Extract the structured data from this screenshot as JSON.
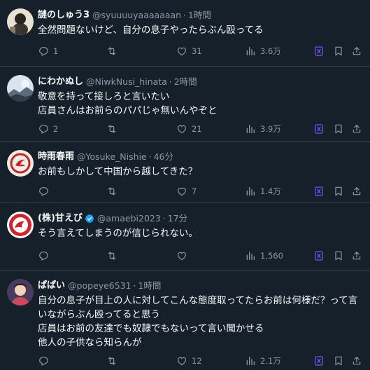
{
  "colors": {
    "background": "#15202b",
    "divider": "#38444d",
    "text": "#f7f9f9",
    "muted": "#8b98a5",
    "verified": "#1d9bf0",
    "grok_icon": "#7856ff"
  },
  "icons": {
    "reply": "reply-icon",
    "retweet": "retweet-icon",
    "like": "like-icon",
    "views": "views-icon",
    "grok": "grok-icon",
    "bookmark": "bookmark-icon",
    "share": "share-icon"
  },
  "tweets": [
    {
      "name": "謎のしゅう3",
      "handle": "@syuuuuyaaaaaaan",
      "time": "1時間",
      "lines": [
        "全然問題ないけど、自分の息子やったらぶん殴ってる"
      ],
      "replies": "1",
      "retweets": "",
      "likes": "31",
      "views": "3.6万"
    },
    {
      "name": "にわかぬし",
      "handle": "@NiwkNusi_hinata",
      "time": "2時間",
      "lines": [
        "敬意を持って接しろと言いたい",
        "店員さんはお前らのパパじゃ無いんやぞと"
      ],
      "replies": "2",
      "retweets": "",
      "likes": "21",
      "views": "3.9万"
    },
    {
      "name": "時雨春雨",
      "handle": "@Yosuke_Nishie",
      "time": "46分",
      "lines": [
        "お前もしかして中国から越してきた？"
      ],
      "replies": "",
      "retweets": "",
      "likes": "7",
      "views": "1.4万"
    },
    {
      "name": "(株)甘えび",
      "handle": "@amaebi2023",
      "time": "17分",
      "lines": [
        "そう言えてしまうのが信じられない。"
      ],
      "replies": "",
      "retweets": "",
      "likes": "",
      "views": "1,560"
    },
    {
      "name": "ぱぱい",
      "handle": "@popeye6531",
      "time": "1時間",
      "lines": [
        "自分の息子が目上の人に対してこんな態度取ってたらお前は何様だ？って言",
        "いながらぶん殴ってると思う",
        "店員はお前の友達でも奴隷でもないって言い聞かせる",
        "他人の子供なら知らんが"
      ],
      "replies": "",
      "retweets": "",
      "likes": "12",
      "views": "2.1万"
    }
  ]
}
